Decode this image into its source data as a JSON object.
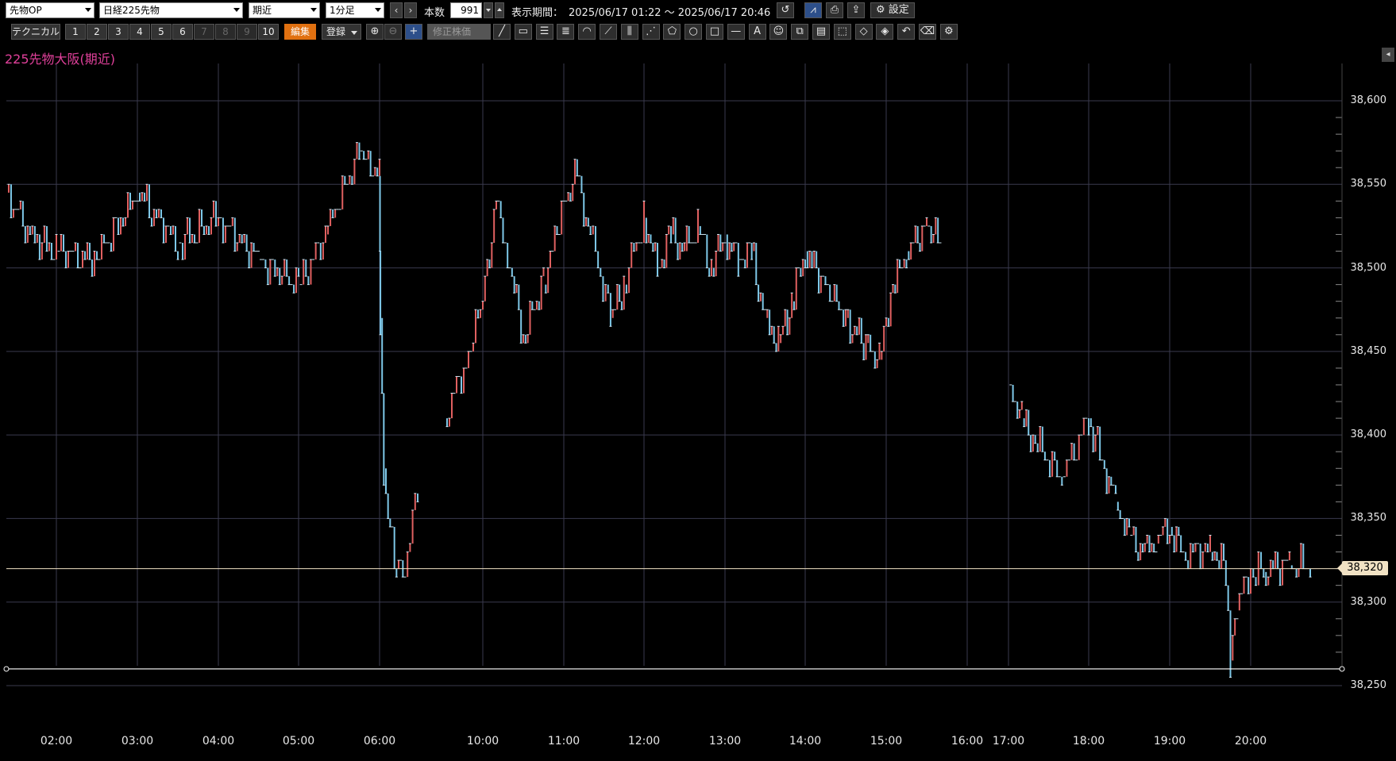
{
  "toolbar": {
    "market_select": "先物OP",
    "product_select": "日経225先物",
    "contract_select": "期近",
    "interval_select": "1分足",
    "prev": "‹",
    "next": "›",
    "count_label": "本数",
    "count_value": "991",
    "period_label": "表示期間：",
    "period_value": "2025/06/17 01:22 ～ 2025/06/17 20:46",
    "settings_label": "設定"
  },
  "toolbar2": {
    "technical": "テクニカル",
    "slots": [
      "1",
      "2",
      "3",
      "4",
      "5",
      "6",
      "7",
      "8",
      "9",
      "10"
    ],
    "edit": "編集",
    "register": "登録",
    "adjusted_price": "修正株価",
    "icons": [
      "zoom-in-icon",
      "zoom-out-icon",
      "crosshair-icon",
      "trend-line-icon",
      "ruler-icon",
      "horizontal-lines-icon",
      "fibonacci-icon",
      "fan-icon",
      "speed-lines-icon",
      "vertical-lines-icon",
      "gann-fan-icon",
      "pentagon-icon",
      "circle-icon",
      "rectangle-icon",
      "horizontal-line-icon",
      "text-icon",
      "icon-stamp-icon",
      "copy-icon",
      "paste-icon",
      "select-icon",
      "eraser-icon",
      "eraser-all-icon",
      "undo-icon",
      "eraser-partial-icon",
      "gear-icon"
    ]
  },
  "chart_title": "225先物大阪(期近)",
  "current_price_label": "38,320",
  "colors": {
    "up": "#e06060",
    "down": "#7ec8e8",
    "grid": "#3a3a4e",
    "title": "#e0409a"
  },
  "chart_data": {
    "type": "line",
    "title": "225先物大阪(期近)",
    "xlabel": "",
    "ylabel": "",
    "ylim": [
      38235,
      38625
    ],
    "y_ticks": [
      "38,600",
      "38,550",
      "38,500",
      "38,450",
      "38,400",
      "38,350",
      "38,300",
      "38,250"
    ],
    "y_tick_values": [
      38600,
      38550,
      38500,
      38450,
      38400,
      38350,
      38300,
      38250
    ],
    "x_ticks": [
      "02:00",
      "03:00",
      "04:00",
      "05:00",
      "06:00",
      "10:00",
      "11:00",
      "12:00",
      "13:00",
      "14:00",
      "15:00",
      "16:00",
      "17:00",
      "18:00",
      "19:00",
      "20:00"
    ],
    "current_price": 38320,
    "horizontal_line": 38260,
    "series": [
      {
        "x": [
          "01:22",
          "01:40",
          "02:00",
          "02:30",
          "03:00",
          "03:30",
          "04:00",
          "04:30",
          "05:00",
          "05:20",
          "05:45",
          "06:00",
          "06:01",
          "06:05",
          "06:10",
          "06:20",
          "06:30",
          "06:45",
          "09:30",
          "09:45",
          "10:00",
          "10:10",
          "10:20",
          "10:30",
          "10:45",
          "11:00",
          "11:10",
          "11:20",
          "11:35",
          "11:45",
          "12:00",
          "12:10",
          "12:20",
          "12:30",
          "12:40",
          "12:50",
          "13:00",
          "13:10",
          "13:20",
          "13:30",
          "13:40",
          "13:50",
          "14:00",
          "14:15",
          "14:30",
          "14:45",
          "14:55",
          "15:05",
          "15:15",
          "15:30",
          "15:40",
          "17:00",
          "17:10",
          "17:20",
          "17:40",
          "18:00",
          "18:10",
          "18:20",
          "18:30",
          "18:40",
          "18:50",
          "19:00",
          "19:10",
          "19:30",
          "19:40",
          "19:45",
          "19:50",
          "20:00",
          "20:10",
          "20:30",
          "20:46"
        ],
        "values": [
          38545,
          38520,
          38510,
          38505,
          38545,
          38515,
          38530,
          38505,
          38490,
          38520,
          38570,
          38555,
          38470,
          38380,
          38350,
          38320,
          38315,
          38370,
          38410,
          38440,
          38480,
          38540,
          38500,
          38460,
          38490,
          38540,
          38555,
          38520,
          38470,
          38490,
          38530,
          38500,
          38520,
          38510,
          38525,
          38500,
          38520,
          38505,
          38510,
          38470,
          38455,
          38480,
          38510,
          38490,
          38470,
          38455,
          38445,
          38490,
          38510,
          38525,
          38515,
          38430,
          38410,
          38395,
          38375,
          38410,
          38385,
          38360,
          38340,
          38330,
          38335,
          38345,
          38330,
          38330,
          38325,
          38265,
          38295,
          38320,
          38318,
          38322,
          38320
        ]
      }
    ]
  }
}
